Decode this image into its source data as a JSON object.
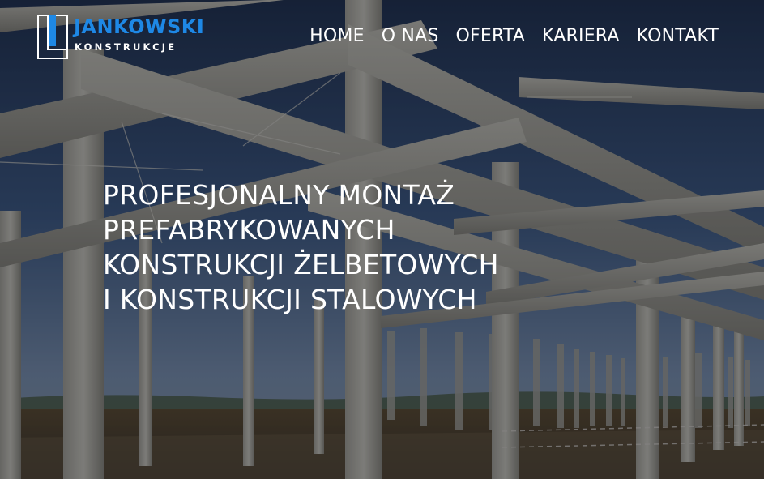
{
  "brand": {
    "name": "JANKOWSKI",
    "tagline": "KONSTRUKCJE",
    "logo_icon": "square-l-logo-icon",
    "accent_color": "#1e88e5"
  },
  "nav": {
    "items": [
      {
        "label": "HOME"
      },
      {
        "label": "O NAS"
      },
      {
        "label": "OFERTA"
      },
      {
        "label": "KARIERA"
      },
      {
        "label": "KONTAKT"
      }
    ]
  },
  "hero": {
    "headline_lines": [
      "PROFESJONALNY MONTAŻ",
      "PREFABRYKOWANYCH",
      "KONSTRUKCJI ŻELBETOWYCH",
      "I KONSTRUKCJI STALOWYCH"
    ]
  }
}
